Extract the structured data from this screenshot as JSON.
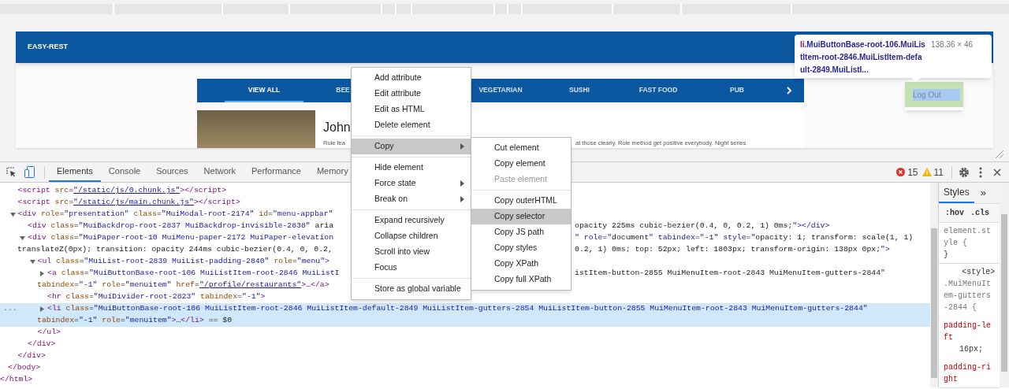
{
  "page": {
    "brand": "EASY-REST",
    "tabs": [
      {
        "label": "VIEW ALL",
        "selected": true
      },
      {
        "label": "BEE",
        "selected": false
      },
      {
        "label": "VEGETARIAN",
        "selected": false
      },
      {
        "label": "SUSHI",
        "selected": false
      },
      {
        "label": "FAST FOOD",
        "selected": false
      },
      {
        "label": "PUB",
        "selected": false
      }
    ],
    "card": {
      "title": "John",
      "text_start": "Rule fea",
      "text_end": "at those clearly. Role method get positive everybody. Night series"
    },
    "tooltip": {
      "selector": "li.MuiButtonBase-root-106.MuiListItem-root-2846.MuiListItem-default-2849.MuiListI...",
      "size": "138.36 × 46"
    },
    "user_menu": [
      {
        "label": "Log Out",
        "highlighted": true
      }
    ]
  },
  "devtools": {
    "tabs": [
      {
        "label": "Elements",
        "selected": true
      },
      {
        "label": "Console",
        "selected": false
      },
      {
        "label": "Sources",
        "selected": false
      },
      {
        "label": "Network",
        "selected": false
      },
      {
        "label": "Performance",
        "selected": false
      },
      {
        "label": "Memory",
        "selected": false
      }
    ],
    "errors": "15",
    "warnings": "11",
    "dom_tree": [
      {
        "close": "</html>",
        "children": [
          {
            "close": "</body>",
            "children": [
              {
                "lines": [
                  {
                    "left": "<script src=\"/static/js/0.chunk.js\"></script>"
                  }
                ]
              },
              {
                "lines": [
                  {
                    "left": "<script src=\"/static/js/main.chunk.js\"></script>"
                  }
                ]
              },
              {
                "expanded": true,
                "lines": [
                  {
                    "left": "<div role=\"presentation\" class=\"MuiModal-root-2174\" id=\"menu-appbar\""
                  }
                ],
                "close": "</div>",
                "children": [
                  {
                    "lines": [
                      {
                        "left": "<div class=\"MuiBackdrop-root-2837 MuiBackdrop-invisible-2838\" aria",
                        "right": "opacity 225ms cubic-bezier(0.4, 0, 0.2, 1) 0ms;\"></div>"
                      }
                    ]
                  },
                  {
                    "expanded": true,
                    "lines": [
                      {
                        "left": "<div class=\"MuiPaper-root-10 MuiMenu-paper-2172 MuiPaper-elevation",
                        "right": "\" role=\"document\" tabindex=\"-1\" style=\"opacity: 1; transform: scale(1, 1)"
                      },
                      {
                        "left": "translateZ(0px); transition: opacity 244ms cubic-bezier(0.4, 0, 0.2,",
                        "right": "0.2, 1) 0ms; top: 52px; left: 1803px; transform-origin: 138px 0px;\">"
                      }
                    ],
                    "close": "</div>",
                    "children": [
                      {
                        "expanded": true,
                        "lines": [
                          {
                            "left": "<ul class=\"MuiList-root-2839 MuiList-padding-2840\" role=\"menu\">"
                          }
                        ],
                        "close": "</ul>",
                        "children": [
                          {
                            "expanded": false,
                            "lines": [
                              {
                                "left": "<a class=\"MuiButtonBase-root-106 MuiListItem-root-2846 MuiListI",
                                "right": "istItem-button-2855 MuiMenuItem-root-2843 MuiMenuItem-gutters-2844\""
                              },
                              {
                                "left": "tabindex=\"-1\" role=\"menuitem\" href=\"/profile/restaurants\">…</a>"
                              }
                            ]
                          },
                          {
                            "lines": [
                              {
                                "left": "<hr class=\"MuiDivider-root-2823\" tabindex=\"-1\">"
                              }
                            ]
                          },
                          {
                            "expanded": false,
                            "selected": true,
                            "gutter": "...",
                            "lines": [
                              {
                                "left": "<li class=\"MuiButtonBase-root-106 MuiListItem-root-2846 MuiListItem-default-2849 MuiListItem-gutters-2854 MuiListItem-button-2855 MuiMenuItem-root-2843 MuiMenuItem-gutters-2844\""
                              },
                              {
                                "left": "tabindex=\"-1\" role=\"menuitem\">…</li> == $0"
                              }
                            ]
                          }
                        ]
                      }
                    ]
                  }
                ]
              }
            ]
          }
        ]
      }
    ],
    "styles_pane": {
      "tabs": [
        {
          "label": "Styles",
          "selected": true
        }
      ],
      "more": "»",
      "filters": [
        ":hov",
        ".cls"
      ],
      "rules": [
        {
          "selector": "element.style {",
          "close": "}"
        },
        {
          "selector": ".MuiMenuItem-gutters-2844 {",
          "source": "<style>",
          "props": [
            {
              "name": "padding-left",
              "value": "16px;"
            },
            {
              "name": "padding-right"
            }
          ]
        }
      ]
    }
  },
  "context_menu": {
    "groups": [
      [
        {
          "label": "Add attribute",
          "kind": "item",
          "selected": false
        },
        {
          "label": "Edit attribute",
          "kind": "item",
          "selected": false
        },
        {
          "label": "Edit as HTML",
          "kind": "item",
          "selected": false
        },
        {
          "label": "Delete element",
          "kind": "item",
          "selected": false
        }
      ],
      [
        {
          "label": "Copy",
          "kind": "submenu",
          "selected": true
        }
      ],
      [
        {
          "label": "Hide element",
          "kind": "item",
          "selected": false
        },
        {
          "label": "Force state",
          "kind": "submenu",
          "selected": false
        },
        {
          "label": "Break on",
          "kind": "submenu",
          "selected": false
        }
      ],
      [
        {
          "label": "Expand recursively",
          "kind": "item",
          "selected": false
        },
        {
          "label": "Collapse children",
          "kind": "item",
          "selected": false
        },
        {
          "label": "Scroll into view",
          "kind": "item",
          "selected": false
        },
        {
          "label": "Focus",
          "kind": "item",
          "selected": false
        }
      ],
      [
        {
          "label": "Store as global variable",
          "kind": "item",
          "selected": false
        }
      ]
    ]
  },
  "copy_submenu": {
    "groups": [
      [
        {
          "label": "Cut element",
          "selected": false,
          "disabled": false
        },
        {
          "label": "Copy element",
          "selected": false,
          "disabled": false
        },
        {
          "label": "Paste element",
          "selected": false,
          "disabled": true
        }
      ],
      [
        {
          "label": "Copy outerHTML",
          "selected": false,
          "disabled": false
        },
        {
          "label": "Copy selector",
          "selected": true,
          "disabled": false
        },
        {
          "label": "Copy JS path",
          "selected": false,
          "disabled": false
        },
        {
          "label": "Copy styles",
          "selected": false,
          "disabled": false
        },
        {
          "label": "Copy XPath",
          "selected": false,
          "disabled": false
        },
        {
          "label": "Copy full XPath",
          "selected": false,
          "disabled": false
        }
      ]
    ]
  }
}
